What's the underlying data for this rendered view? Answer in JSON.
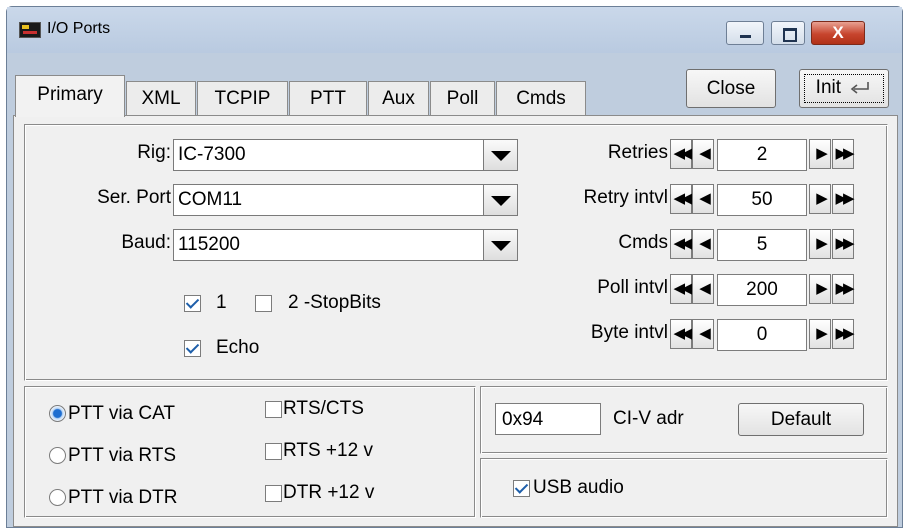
{
  "window": {
    "title": "I/O Ports",
    "caption_buttons": [
      "minimize-icon",
      "maximize-icon",
      "close-icon"
    ],
    "close_glyph": "X"
  },
  "tabs": [
    {
      "label": "Primary",
      "active": true
    },
    {
      "label": "XML"
    },
    {
      "label": "TCPIP"
    },
    {
      "label": "PTT"
    },
    {
      "label": "Aux"
    },
    {
      "label": "Poll"
    },
    {
      "label": "Cmds"
    }
  ],
  "buttons": {
    "close": "Close",
    "init": "Init",
    "init_icon": "enter-arrow-icon",
    "default": "Default"
  },
  "serial": {
    "rig_label": "Rig:",
    "rig_value": "IC-7300",
    "port_label": "Ser. Port",
    "port_value": "COM11",
    "baud_label": "Baud:",
    "baud_value": "115200",
    "stopbits_1": "1",
    "stopbits_1_checked": true,
    "stopbits_2": "2 -StopBits",
    "stopbits_2_checked": false,
    "echo": "Echo",
    "echo_checked": true
  },
  "spinners": [
    {
      "label": "Retries",
      "value": "2"
    },
    {
      "label": "Retry intvl",
      "value": "50"
    },
    {
      "label": "Cmds",
      "value": "5"
    },
    {
      "label": "Poll intvl",
      "value": "200"
    },
    {
      "label": "Byte intvl",
      "value": "0"
    }
  ],
  "spin_glyphs": {
    "first": "◀◀",
    "prev": "◀",
    "next": "▶",
    "last": "▶▶"
  },
  "ptt": {
    "via_cat": "PTT via CAT",
    "via_rts": "PTT via RTS",
    "via_dtr": "PTT via DTR",
    "selected": "via_cat",
    "rts_cts": "RTS/CTS",
    "rts_12v": "RTS +12 v",
    "dtr_12v": "DTR +12 v"
  },
  "civ": {
    "address": "0x94",
    "label": "CI-V adr"
  },
  "usb_audio": {
    "label": "USB audio",
    "checked": true
  },
  "colors": {
    "window_frame": "#bfcdde",
    "panel_bg": "#f0f0f0",
    "close_button": "#c7452e",
    "check_accent": "#1e5faa"
  }
}
